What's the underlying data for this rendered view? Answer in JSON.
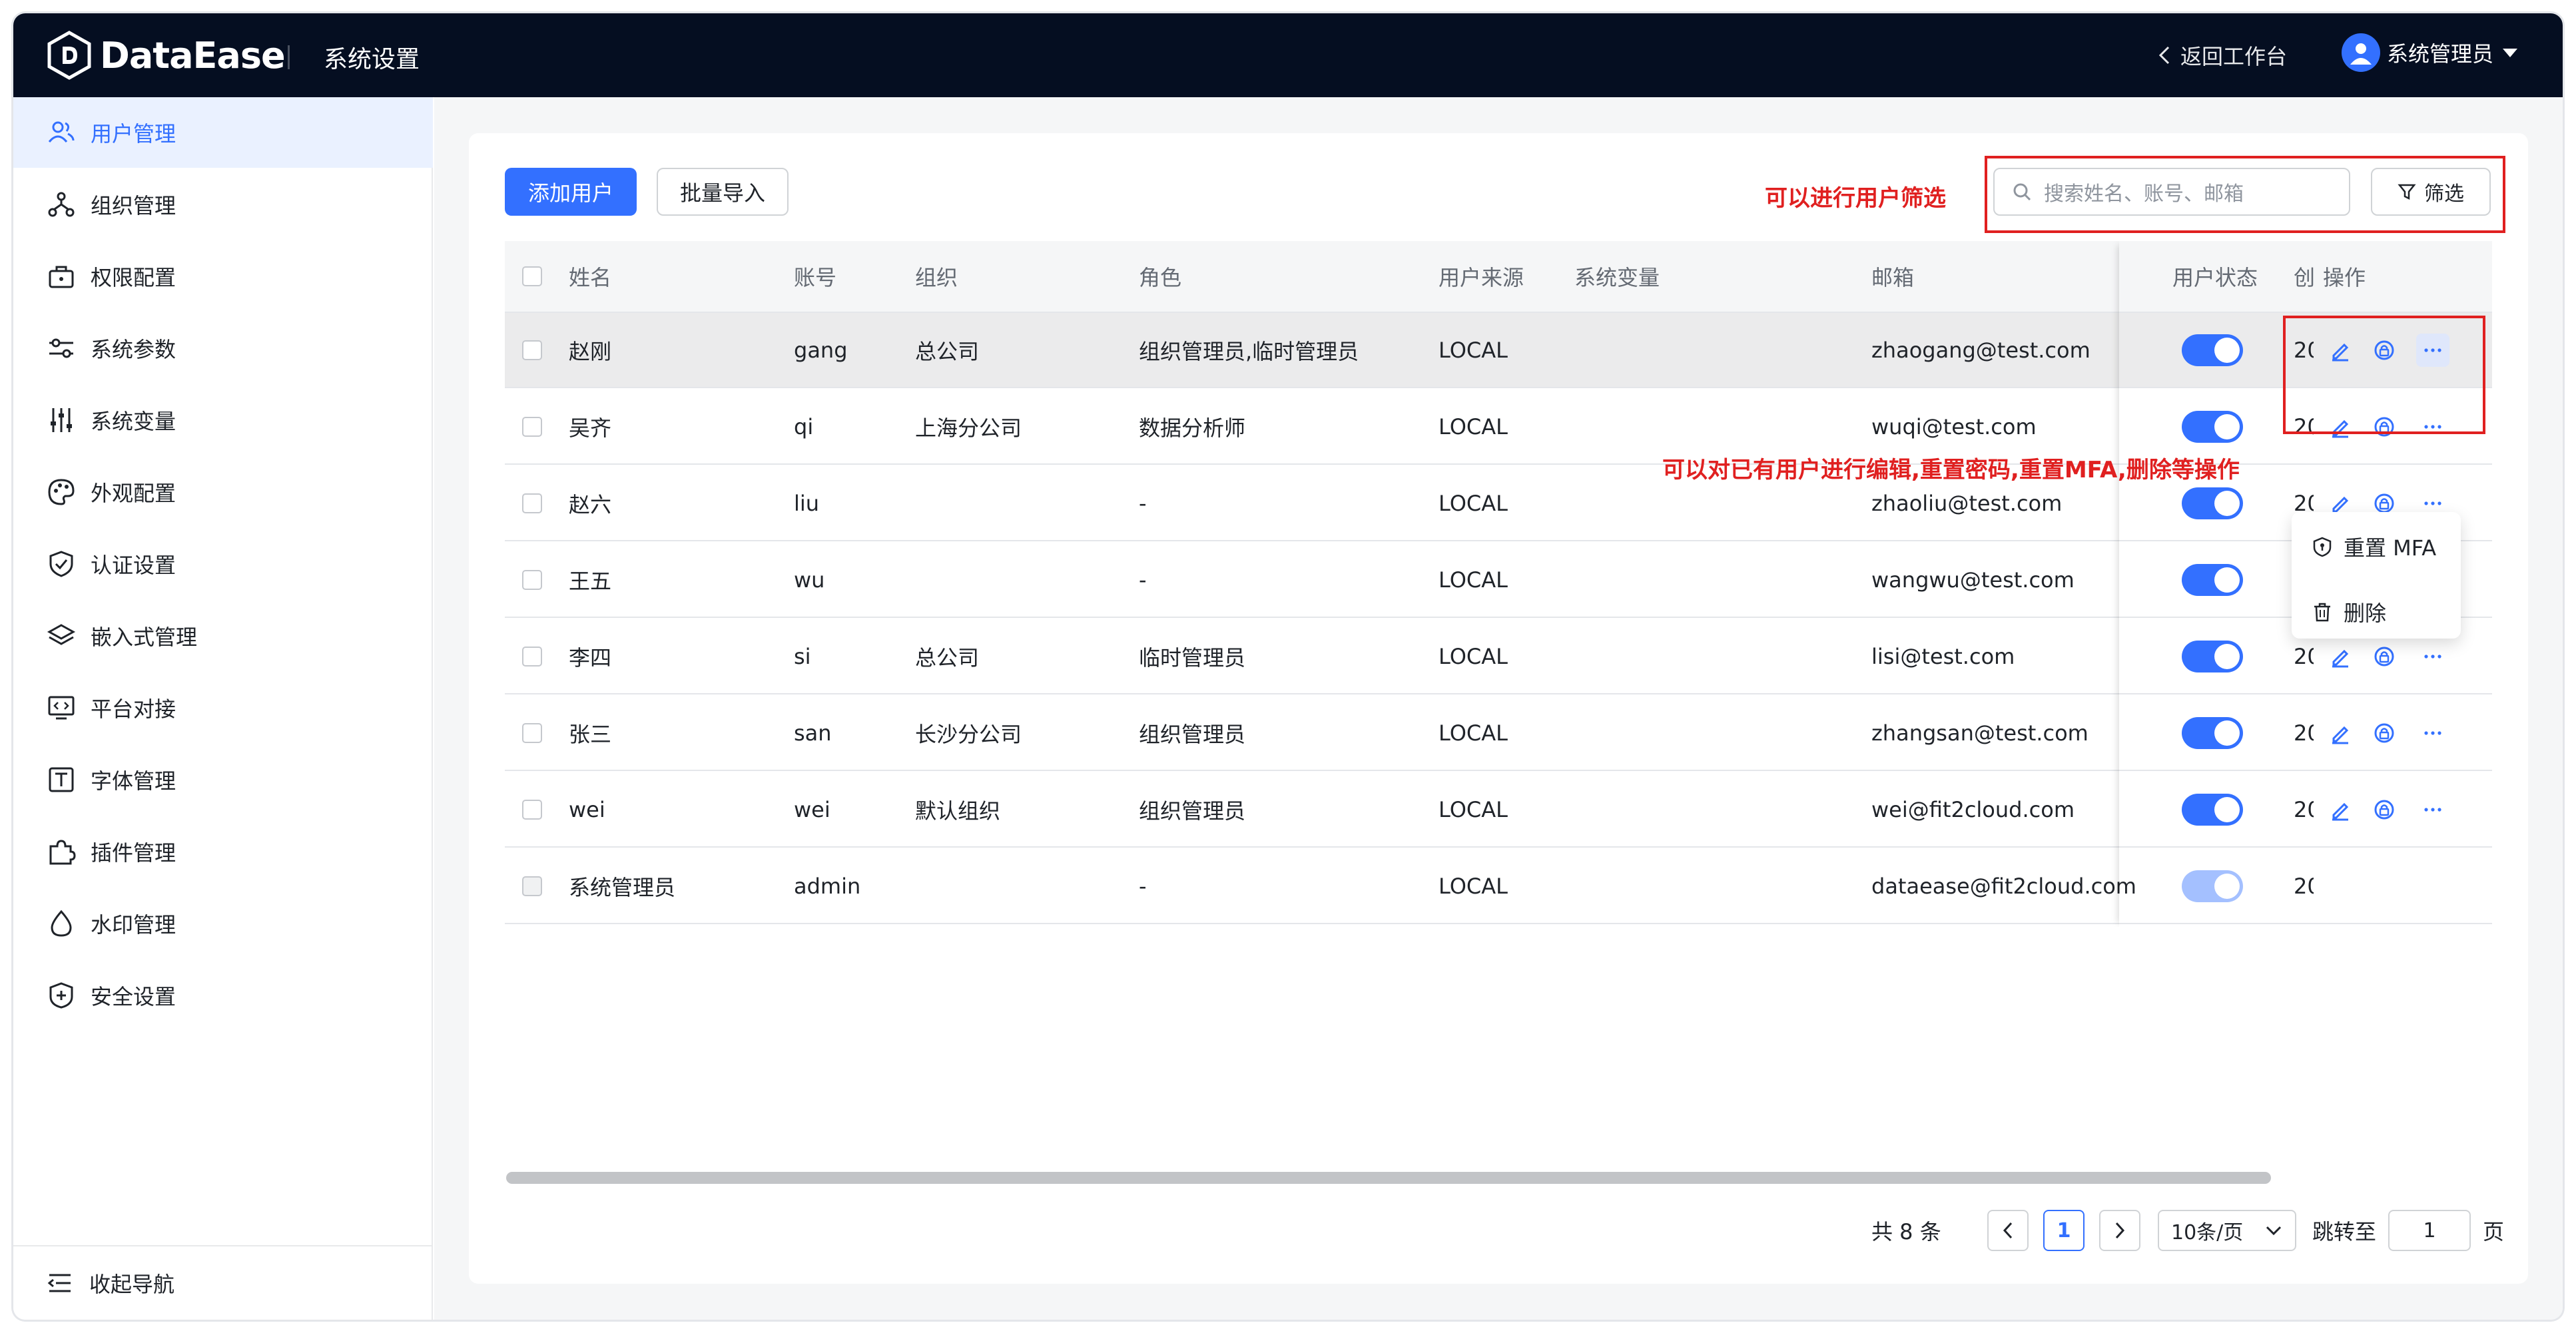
{
  "header": {
    "brand": "DataEase",
    "title": "系统设置",
    "back_label": "返回工作台",
    "user_name": "系统管理员"
  },
  "sidebar": {
    "items": [
      {
        "label": "用户管理",
        "icon": "users-icon",
        "active": true
      },
      {
        "label": "组织管理",
        "icon": "org-tree-icon"
      },
      {
        "label": "权限配置",
        "icon": "lock-briefcase-icon"
      },
      {
        "label": "系统参数",
        "icon": "sliders-icon"
      },
      {
        "label": "系统变量",
        "icon": "vertical-sliders-icon"
      },
      {
        "label": "外观配置",
        "icon": "palette-icon"
      },
      {
        "label": "认证设置",
        "icon": "shield-check-icon"
      },
      {
        "label": "嵌入式管理",
        "icon": "layers-icon"
      },
      {
        "label": "平台对接",
        "icon": "monitor-code-icon"
      },
      {
        "label": "字体管理",
        "icon": "font-icon"
      },
      {
        "label": "插件管理",
        "icon": "puzzle-icon"
      },
      {
        "label": "水印管理",
        "icon": "droplet-icon"
      },
      {
        "label": "安全设置",
        "icon": "shield-plus-icon"
      }
    ],
    "collapse_label": "收起导航"
  },
  "toolbar": {
    "add_user": "添加用户",
    "batch_import": "批量导入",
    "search_placeholder": "搜索姓名、账号、邮箱",
    "filter": "筛选"
  },
  "annotations": {
    "filter_note": "可以进行用户筛选",
    "ops_note": "可以对已有用户进行编辑,重置密码,重置MFA,删除等操作"
  },
  "table": {
    "headers": {
      "name": "姓名",
      "account": "账号",
      "org": "组织",
      "role": "角色",
      "source": "用户来源",
      "variable": "系统变量",
      "email": "邮箱",
      "status": "用户状态",
      "created": "创",
      "ops": "操作"
    },
    "rows": [
      {
        "name": "赵刚",
        "account": "gang",
        "org": "总公司",
        "role": "组织管理员,临时管理员",
        "source": "LOCAL",
        "variable": "",
        "email": "zhaogang@test.com",
        "enabled": true,
        "created": "20"
      },
      {
        "name": "吴齐",
        "account": "qi",
        "org": "上海分公司",
        "role": "数据分析师",
        "source": "LOCAL",
        "variable": "",
        "email": "wuqi@test.com",
        "enabled": true,
        "created": "20"
      },
      {
        "name": "赵六",
        "account": "liu",
        "org": "",
        "role": "-",
        "source": "LOCAL",
        "variable": "",
        "email": "zhaoliu@test.com",
        "enabled": true,
        "created": "20"
      },
      {
        "name": "王五",
        "account": "wu",
        "org": "",
        "role": "-",
        "source": "LOCAL",
        "variable": "",
        "email": "wangwu@test.com",
        "enabled": true,
        "created": "20"
      },
      {
        "name": "李四",
        "account": "si",
        "org": "总公司",
        "role": "临时管理员",
        "source": "LOCAL",
        "variable": "",
        "email": "lisi@test.com",
        "enabled": true,
        "created": "20"
      },
      {
        "name": "张三",
        "account": "san",
        "org": "长沙分公司",
        "role": "组织管理员",
        "source": "LOCAL",
        "variable": "",
        "email": "zhangsan@test.com",
        "enabled": true,
        "created": "20"
      },
      {
        "name": "wei",
        "account": "wei",
        "org": "默认组织",
        "role": "组织管理员",
        "source": "LOCAL",
        "variable": "",
        "email": "wei@fit2cloud.com",
        "enabled": true,
        "created": "20"
      },
      {
        "name": "系统管理员",
        "account": "admin",
        "org": "",
        "role": "-",
        "source": "LOCAL",
        "variable": "",
        "email": "dataease@fit2cloud.com",
        "enabled": true,
        "created": "20"
      }
    ]
  },
  "dropdown": {
    "reset_mfa": "重置 MFA",
    "delete": "删除"
  },
  "pagination": {
    "total": "共 8 条",
    "current_page": "1",
    "page_size": "10条/页",
    "goto_label": "跳转至",
    "goto_value": "1",
    "page_suffix": "页"
  },
  "colors": {
    "primary": "#3370ff",
    "header_bg": "#050e21",
    "annotation": "#e02020"
  }
}
